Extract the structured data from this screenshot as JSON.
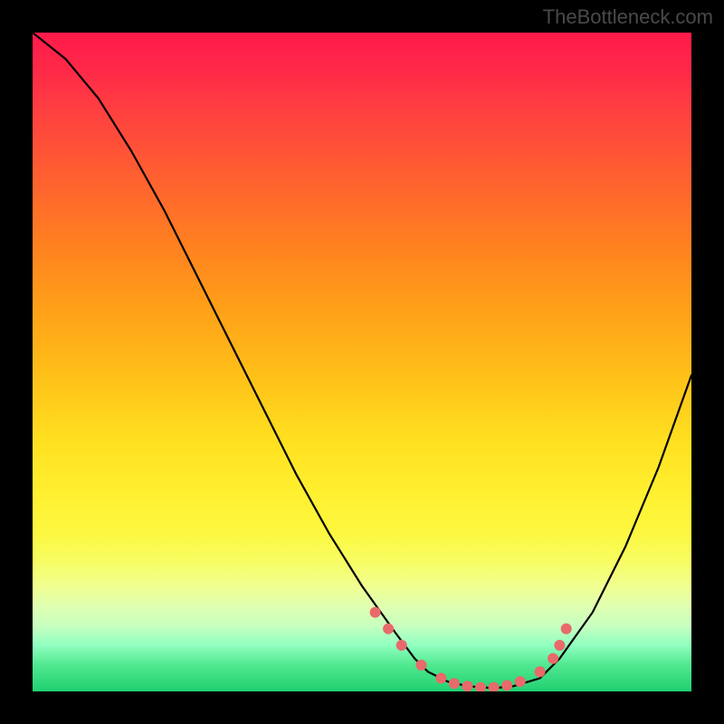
{
  "watermark": "TheBottleneck.com",
  "chart_data": {
    "type": "line",
    "title": "",
    "xlabel": "",
    "ylabel": "",
    "xlim": [
      0,
      100
    ],
    "ylim": [
      0,
      100
    ],
    "grid": false,
    "series": [
      {
        "name": "bottleneck-curve",
        "x": [
          0,
          5,
          10,
          15,
          20,
          25,
          30,
          35,
          40,
          45,
          50,
          55,
          58,
          60,
          63,
          66,
          70,
          73,
          77,
          80,
          85,
          90,
          95,
          100
        ],
        "y": [
          100,
          96,
          90,
          82,
          73,
          63,
          53,
          43,
          33,
          24,
          16,
          9,
          5,
          3,
          1.5,
          0.8,
          0.5,
          0.8,
          2,
          5,
          12,
          22,
          34,
          48
        ]
      }
    ],
    "markers": {
      "name": "highlight-dots",
      "color": "#e86a6a",
      "x": [
        52,
        54,
        56,
        59,
        62,
        64,
        66,
        68,
        70,
        72,
        74,
        77,
        79,
        80,
        81
      ],
      "y": [
        12,
        9.5,
        7,
        4,
        2,
        1.2,
        0.8,
        0.6,
        0.6,
        0.9,
        1.5,
        3,
        5,
        7,
        9.5
      ]
    },
    "background": {
      "type": "vertical-gradient",
      "stops": [
        {
          "pos": 0,
          "color": "#ff1a4a"
        },
        {
          "pos": 50,
          "color": "#ffc018"
        },
        {
          "pos": 80,
          "color": "#f8fc60"
        },
        {
          "pos": 100,
          "color": "#20d070"
        }
      ]
    }
  }
}
